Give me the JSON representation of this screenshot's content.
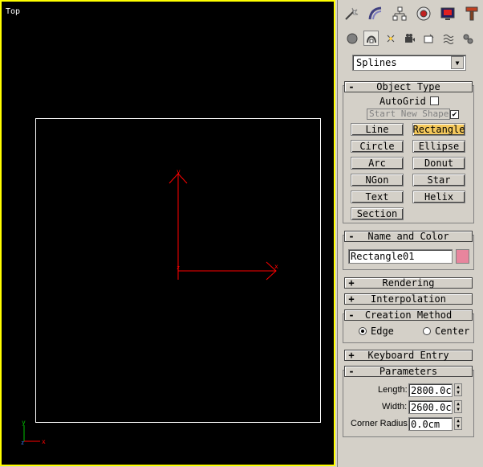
{
  "viewport": {
    "label": "Top",
    "border_color": "#ffff00",
    "axis_color": "#ff0000"
  },
  "panel": {
    "tabs": [
      "create-icon",
      "modify-icon",
      "hierarchy-icon",
      "motion-icon",
      "display-icon",
      "utilities-icon"
    ],
    "subtabs": [
      "geometry-icon",
      "shapes-icon",
      "lights-icon",
      "cameras-icon",
      "helpers-icon",
      "spacewarps-icon",
      "systems-icon"
    ],
    "category": "Splines",
    "object_type": {
      "title": "Object Type",
      "autogrid": "AutoGrid",
      "start_new_shape": "Start New Shape",
      "buttons": [
        "Line",
        "Rectangle",
        "Circle",
        "Ellipse",
        "Arc",
        "Donut",
        "NGon",
        "Star",
        "Text",
        "Helix",
        "Section"
      ],
      "active": "Rectangle",
      "active_color": "#f5c95c"
    },
    "name_color": {
      "title": "Name and Color",
      "name": "Rectangle01",
      "swatch": "#e8859d"
    },
    "rendering": {
      "title": "Rendering"
    },
    "interpolation": {
      "title": "Interpolation"
    },
    "creation_method": {
      "title": "Creation Method",
      "edge": "Edge",
      "center": "Center"
    },
    "keyboard_entry": {
      "title": "Keyboard Entry"
    },
    "parameters": {
      "title": "Parameters",
      "length_label": "Length:",
      "length": "2800.0c",
      "width_label": "Width:",
      "width": "2600.0c",
      "corner_label": "Corner Radius:",
      "corner": "0.0cm"
    }
  }
}
